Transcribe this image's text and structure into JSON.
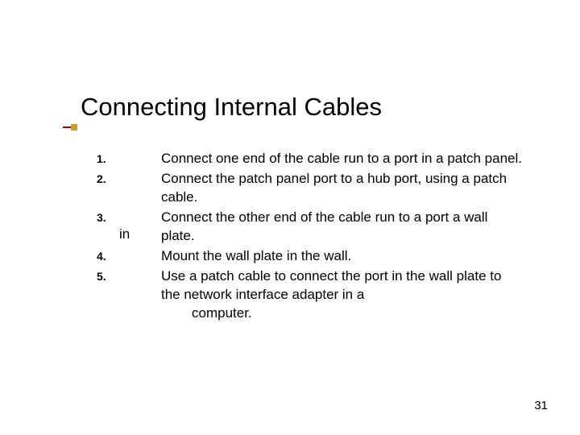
{
  "slide": {
    "title": "Connecting Internal Cables",
    "items": [
      {
        "num": "1.",
        "sub": "",
        "text": "Connect one end of the cable run to a port in a patch panel."
      },
      {
        "num": "2.",
        "sub": "",
        "text": "Connect the patch panel port to a hub port, using a patch cable."
      },
      {
        "num": "3.",
        "sub": "in",
        "text": "Connect the other end of the cable run to a port a wall plate."
      },
      {
        "num": "4.",
        "sub": "",
        "text": "Mount the wall plate in the wall."
      },
      {
        "num": "5.",
        "sub": "",
        "text": "Use a patch cable to connect the port in the wall plate to the network interface adapter in a"
      }
    ],
    "trailing": "computer.",
    "page_number": "31"
  }
}
